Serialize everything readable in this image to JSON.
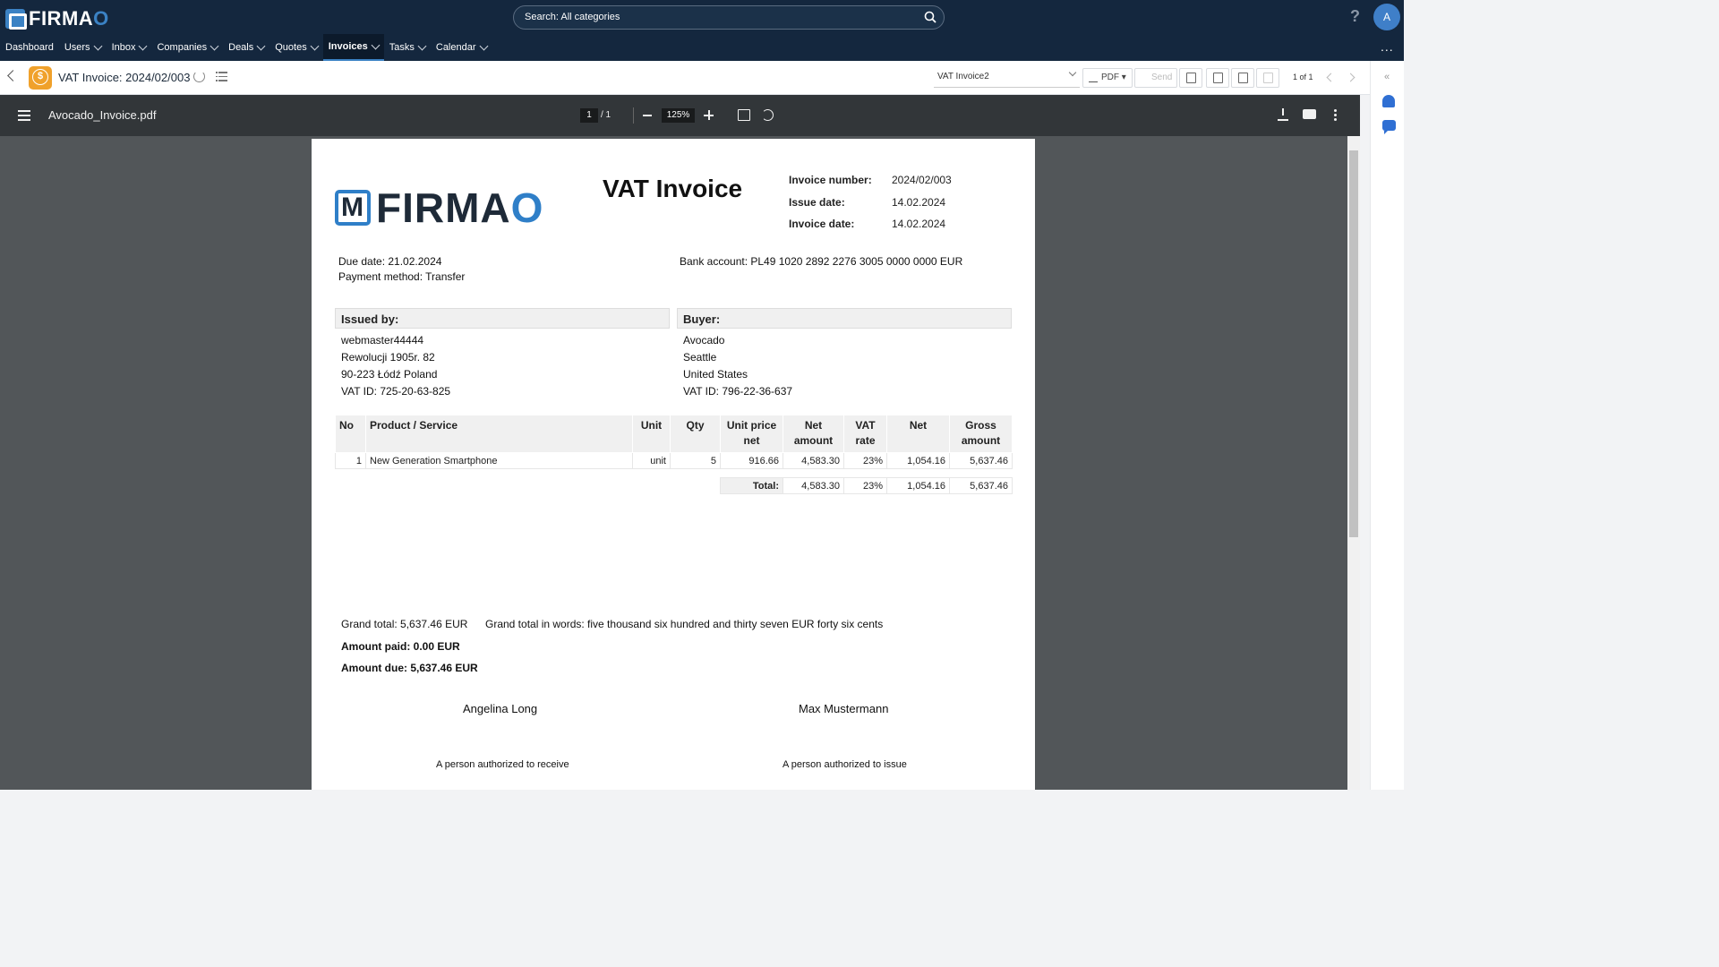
{
  "app": {
    "logo_text_main": "FIRMA",
    "logo_text_o": "O"
  },
  "search": {
    "placeholder": "Search: All categories"
  },
  "user": {
    "avatar_initial": "A"
  },
  "nav": {
    "items": [
      {
        "label": "Dashboard"
      },
      {
        "label": "Users"
      },
      {
        "label": "Inbox"
      },
      {
        "label": "Companies"
      },
      {
        "label": "Deals"
      },
      {
        "label": "Quotes"
      },
      {
        "label": "Invoices"
      },
      {
        "label": "Tasks"
      },
      {
        "label": "Calendar"
      }
    ],
    "active": "Invoices",
    "more": "..."
  },
  "record": {
    "title": "VAT Invoice: 2024/02/003",
    "template": "VAT Invoice2",
    "pdf_label": "PDF",
    "send_label": "Send",
    "pager": "1 of 1"
  },
  "viewer": {
    "filename": "Avocado_Invoice.pdf",
    "page": "1",
    "page_total": "/ 1",
    "zoom": "125%"
  },
  "invoice": {
    "logo_main": "FIRMA",
    "logo_o": "O",
    "title": "VAT Invoice",
    "meta": [
      {
        "label": "Invoice number:",
        "value": "2024/02/003"
      },
      {
        "label": "Issue date:",
        "value": "14.02.2024"
      },
      {
        "label": "Invoice date:",
        "value": "14.02.2024"
      }
    ],
    "due_date": "Due date: 21.02.2024",
    "payment_method": "Payment method: Transfer",
    "bank_account": "Bank account: PL49 1020 2892 2276 3005 0000 0000 EUR",
    "issued_by": {
      "heading": "Issued by:",
      "lines": [
        "webmaster44444",
        "Rewolucji 1905r. 82",
        "90-223 Łódź Poland",
        "VAT ID:  725-20-63-825"
      ]
    },
    "buyer": {
      "heading": "Buyer:",
      "lines": [
        "Avocado",
        "Seattle",
        "United States",
        "VAT ID:  796-22-36-637"
      ]
    },
    "columns": {
      "no": "No",
      "product": "Product / Service",
      "unit": "Unit",
      "qty": "Qty",
      "unit_price_1": "Unit price",
      "unit_price_2": "net",
      "net_amount_1": "Net",
      "net_amount_2": "amount",
      "vat_rate_1": "VAT",
      "vat_rate_2": "rate",
      "net": "Net",
      "gross_1": "Gross",
      "gross_2": "amount"
    },
    "rows": [
      {
        "no": "1",
        "product": "New Generation Smartphone",
        "unit": "unit",
        "qty": "5",
        "unit_price": "916.66",
        "net_amount": "4,583.30",
        "vat_rate": "23%",
        "net": "1,054.16",
        "gross": "5,637.46"
      }
    ],
    "totals": {
      "label": "Total:",
      "net_amount": "4,583.30",
      "vat_rate": "23%",
      "net": "1,054.16",
      "gross": "5,637.46"
    },
    "grand_total": "Grand total: 5,637.46 EUR",
    "grand_total_words": "Grand total in words: five thousand six hundred and thirty seven EUR forty six  cents",
    "amount_paid": "Amount paid: 0.00 EUR",
    "amount_due": "Amount due: 5,637.46 EUR",
    "receiver_name": "Angelina Long",
    "issuer_name": "Max Mustermann",
    "receiver_caption": "A person authorized to receive",
    "issuer_caption": "A person authorized to issue"
  }
}
